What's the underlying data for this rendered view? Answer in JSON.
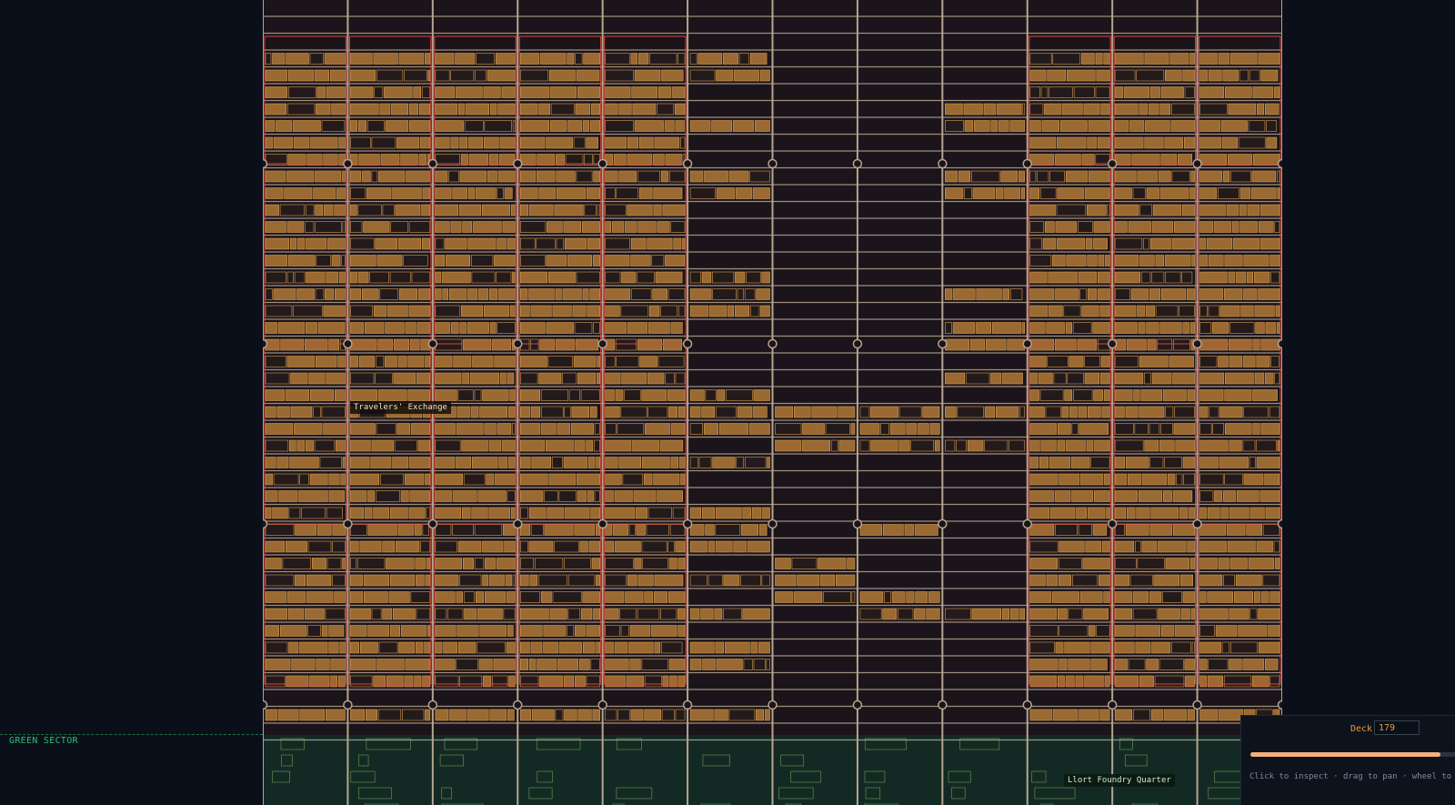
{
  "map": {
    "sectors": [
      {
        "name": "GREEN SECTOR",
        "color": "#27c36a"
      }
    ],
    "districts": [
      {
        "name": "Travelers' Exchange"
      },
      {
        "name": "Llort Foundry Quarter"
      }
    ],
    "colors": {
      "background": "#0b0f1a",
      "hull": "#1b141a",
      "beam": "#b6a58f",
      "module_fill": "#9a6a32",
      "module_stroke": "#d79b4d",
      "district_border": "#d8473d",
      "green_sector_fill": "#132a24",
      "green_module": "#6f9a55"
    }
  },
  "controls": {
    "deck_label": "Deck",
    "deck_value": "179",
    "deck_progress": 0.9,
    "hint": "Click to inspect · drag to pan · wheel to zoom"
  }
}
